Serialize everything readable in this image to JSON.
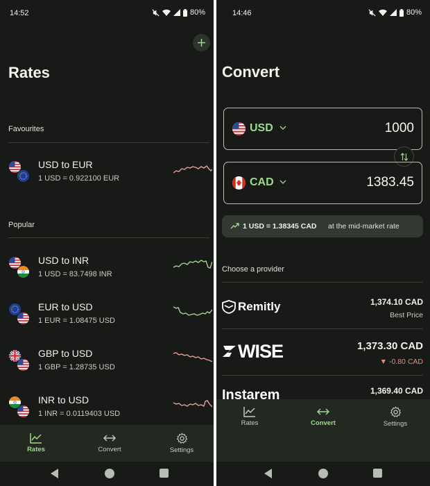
{
  "rates_screen": {
    "status": {
      "time": "14:52",
      "battery": "80%"
    },
    "title": "Rates",
    "favourites_label": "Favourites",
    "popular_label": "Popular",
    "favourites": [
      {
        "name": "USD to EUR",
        "rate": "1 USD = 0.922100 EUR",
        "flags": [
          "us",
          "eu"
        ],
        "trend": "down"
      }
    ],
    "popular": [
      {
        "name": "USD to INR",
        "rate": "1 USD = 83.7498 INR",
        "flags": [
          "us",
          "in"
        ],
        "trend": "up"
      },
      {
        "name": "EUR to USD",
        "rate": "1 EUR = 1.08475 USD",
        "flags": [
          "eu",
          "us"
        ],
        "trend": "up"
      },
      {
        "name": "GBP to USD",
        "rate": "1 GBP = 1.28735 USD",
        "flags": [
          "gb",
          "us"
        ],
        "trend": "down"
      },
      {
        "name": "INR to USD",
        "rate": "1 INR = 0.0119403 USD",
        "flags": [
          "in",
          "us"
        ],
        "trend": "down"
      }
    ],
    "nav": [
      {
        "label": "Rates",
        "icon": "chart-icon",
        "active": true
      },
      {
        "label": "Convert",
        "icon": "convert-icon",
        "active": false
      },
      {
        "label": "Settings",
        "icon": "gear-icon",
        "active": false
      }
    ]
  },
  "convert_screen": {
    "status": {
      "time": "14:46",
      "battery": "80%"
    },
    "title": "Convert",
    "from": {
      "code": "USD",
      "amount": "1000",
      "flag": "us"
    },
    "to": {
      "code": "CAD",
      "amount": "1383.45",
      "flag": "ca"
    },
    "mid_rate": {
      "strong": "1 USD = 1.38345 CAD",
      "suffix": "at the mid-market rate"
    },
    "providers_label": "Choose a provider",
    "providers": [
      {
        "name": "Remitly",
        "price": "1,374.10 CAD",
        "note": "Best Price"
      },
      {
        "name": "WISE",
        "price": "1,373.30 CAD",
        "note": "▼ -0.80 CAD"
      },
      {
        "name": "Instarem",
        "price": "1,369.40 CAD",
        "note": ""
      }
    ],
    "nav": [
      {
        "label": "Rates",
        "icon": "chart-icon",
        "active": false
      },
      {
        "label": "Convert",
        "icon": "convert-icon",
        "active": true
      },
      {
        "label": "Settings",
        "icon": "gear-icon",
        "active": false
      }
    ]
  },
  "colors": {
    "background": "#171a16",
    "accent_green": "#9fd98e",
    "spark_down": "#e9a39a",
    "spark_up": "#9fd98e",
    "negative": "#e78b7d"
  }
}
